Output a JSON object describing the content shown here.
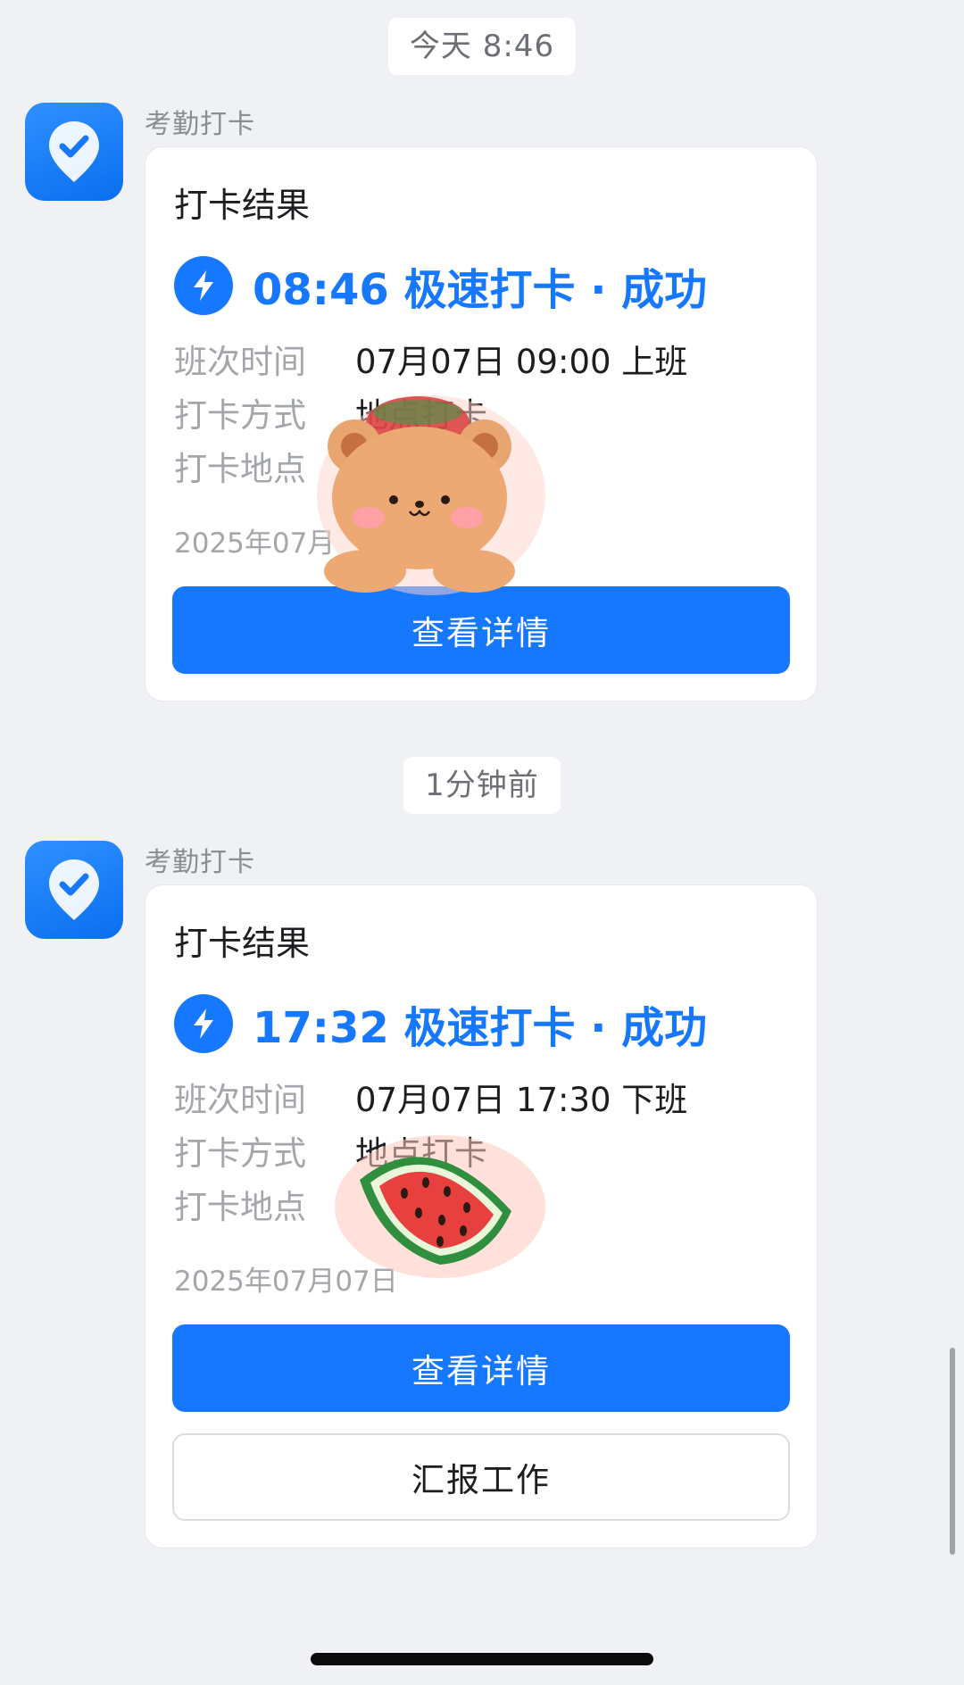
{
  "messages": [
    {
      "time": "今天 8:46",
      "sender": "考勤打卡",
      "card": {
        "title": "打卡结果",
        "status": "08:46 极速打卡 · 成功",
        "shift_label": "班次时间",
        "shift_value": "07月07日 09:00 上班",
        "method_label": "打卡方式",
        "method_value": "地点打卡",
        "location_label": "打卡地点",
        "date": "2025年07月",
        "primary_button": "查看详情"
      }
    },
    {
      "time": "1分钟前",
      "sender": "考勤打卡",
      "card": {
        "title": "打卡结果",
        "status": "17:32 极速打卡 · 成功",
        "shift_label": "班次时间",
        "shift_value": "07月07日 17:30 下班",
        "method_label": "打卡方式",
        "method_value": "地点打卡",
        "location_label": "打卡地点",
        "date": "2025年07月07日",
        "primary_button": "查看详情",
        "secondary_button": "汇报工作"
      }
    }
  ],
  "colors": {
    "accent": "#1677ff",
    "background": "#f0f1f4"
  },
  "icons": {
    "avatar": "location-check-icon",
    "status": "lightning-bolt-icon"
  }
}
